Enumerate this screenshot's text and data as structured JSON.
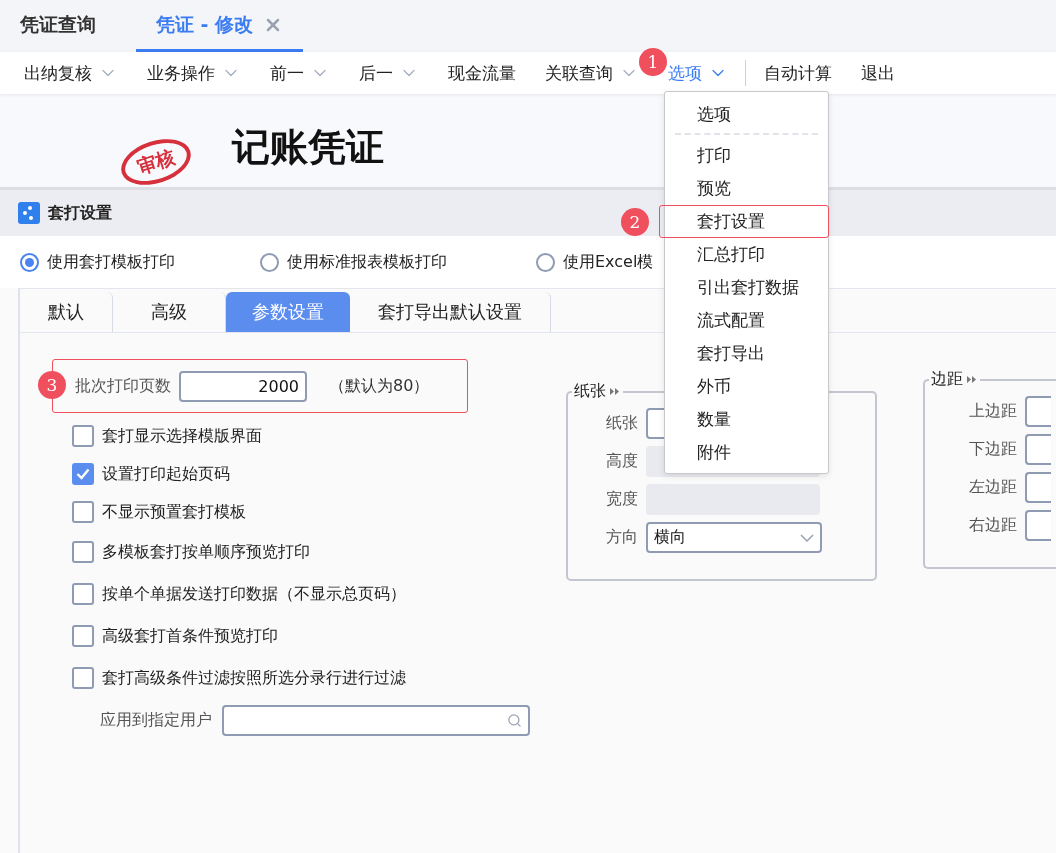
{
  "tabs": [
    {
      "label": "凭证查询",
      "selected": false,
      "closable": false
    },
    {
      "label": "凭证 - 修改",
      "selected": true,
      "closable": true
    }
  ],
  "toolbar": [
    {
      "label": "出纳复核",
      "dropdown": true,
      "selected": false,
      "divider_before": false
    },
    {
      "label": "业务操作",
      "dropdown": true,
      "selected": false,
      "divider_before": false
    },
    {
      "label": "前一",
      "dropdown": true,
      "selected": false,
      "divider_before": false
    },
    {
      "label": "后一",
      "dropdown": true,
      "selected": false,
      "divider_before": false
    },
    {
      "label": "现金流量",
      "dropdown": false,
      "selected": false,
      "divider_before": false
    },
    {
      "label": "关联查询",
      "dropdown": true,
      "selected": false,
      "divider_before": false
    },
    {
      "label": "选项",
      "dropdown": true,
      "selected": true,
      "divider_before": false,
      "callout": "1"
    },
    {
      "label": "自动计算",
      "dropdown": false,
      "selected": false,
      "divider_before": true
    },
    {
      "label": "退出",
      "dropdown": false,
      "selected": false,
      "divider_before": false
    }
  ],
  "menu": {
    "items": [
      {
        "label": "选项",
        "kind": "header"
      },
      {
        "label": "打印",
        "kind": "item"
      },
      {
        "label": "预览",
        "kind": "item"
      },
      {
        "label": "套打设置",
        "kind": "item",
        "highlighted": true,
        "callout": "2"
      },
      {
        "label": "汇总打印",
        "kind": "item"
      },
      {
        "label": "引出套打数据",
        "kind": "item"
      },
      {
        "label": "流式配置",
        "kind": "item"
      },
      {
        "label": "套打导出",
        "kind": "item"
      },
      {
        "label": "外币",
        "kind": "item"
      },
      {
        "label": "数量",
        "kind": "item"
      },
      {
        "label": "附件",
        "kind": "item"
      }
    ]
  },
  "voucher": {
    "stamp": "审核",
    "title": "记账凭证"
  },
  "dialog": {
    "title": "套打设置"
  },
  "print_modes": [
    {
      "label": "使用套打模板打印",
      "selected": true
    },
    {
      "label": "使用标准报表模板打印",
      "selected": false
    },
    {
      "label": "使用Excel模",
      "selected": false
    }
  ],
  "panel_tabs": [
    {
      "label": "默认",
      "selected": false
    },
    {
      "label": "高级",
      "selected": false
    },
    {
      "label": "参数设置",
      "selected": true
    },
    {
      "label": "套打导出默认设置",
      "selected": false
    }
  ],
  "batch": {
    "label": "批次打印页数",
    "value": "2000",
    "hint": "（默认为80）",
    "highlighted": true,
    "callout": "3"
  },
  "options": [
    {
      "label": "套打显示选择模版界面",
      "checked": false
    },
    {
      "label": "设置打印起始页码",
      "checked": true
    },
    {
      "label": "不显示预置套打模板",
      "checked": false
    },
    {
      "label": "多模板套打按单顺序预览打印",
      "checked": false
    },
    {
      "label": "按单个单据发送打印数据（不显示总页码）",
      "checked": false
    },
    {
      "label": "高级套打首条件预览打印",
      "checked": false
    },
    {
      "label": "套打高级条件过滤按照所选分录行进行过滤",
      "checked": false
    }
  ],
  "user_field": {
    "label": "应用到指定用户"
  },
  "paper": {
    "title": "纸张",
    "fields": [
      {
        "label": "纸张",
        "kind": "input"
      },
      {
        "label": "高度",
        "kind": "disabled"
      },
      {
        "label": "宽度",
        "kind": "disabled"
      },
      {
        "label": "方向",
        "kind": "select",
        "value": "横向"
      }
    ]
  },
  "margins": {
    "title": "边距",
    "fields": [
      {
        "label": "上边距"
      },
      {
        "label": "下边距"
      },
      {
        "label": "左边距"
      },
      {
        "label": "右边距"
      }
    ]
  }
}
